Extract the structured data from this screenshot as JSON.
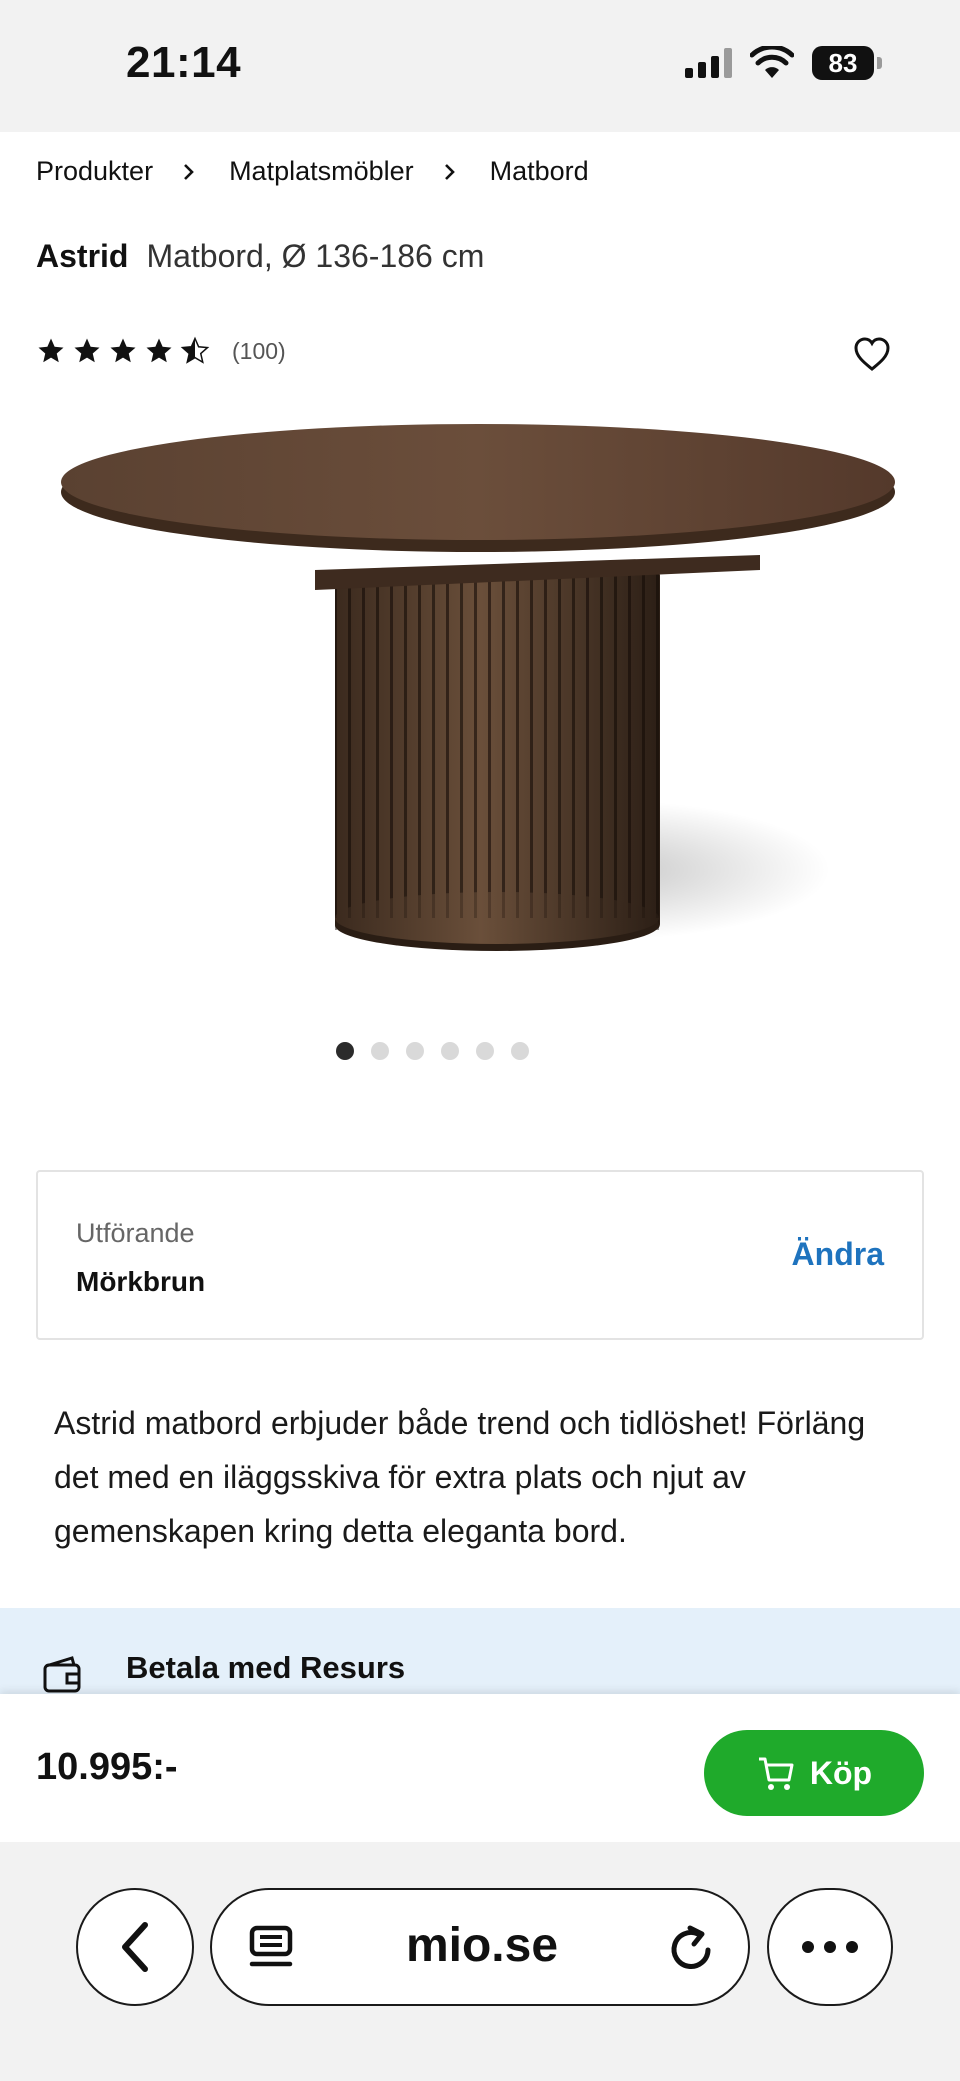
{
  "status_bar": {
    "time": "21:14",
    "battery": "83"
  },
  "breadcrumb": [
    "Produkter",
    "Matplatsmöbler",
    "Matbord"
  ],
  "product": {
    "brand": "Astrid",
    "description_short": "Matbord, Ø 136-186 cm",
    "rating": 4.5,
    "review_count": "(100)",
    "image_name": "round-dark-brown-dining-table",
    "gallery_total": 6,
    "gallery_active": 1
  },
  "variant": {
    "label": "Utförande",
    "value": "Mörkbrun",
    "change_label": "Ändra"
  },
  "description": "Astrid matbord erbjuder både trend och tidlöshet! Förläng det med en iläggsskiva för extra plats och njut av gemenskapen kring detta eleganta bord.",
  "payment_banner": {
    "text": "Betala med Resurs",
    "icon": "wallet-icon"
  },
  "buy_bar": {
    "price": "10.995:-",
    "button_label": "Köp",
    "button_color": "#1faa2b"
  },
  "browser": {
    "url": "mio.se"
  },
  "colors": {
    "link_blue": "#1e73be",
    "banner_bg": "#e4f0fa"
  }
}
